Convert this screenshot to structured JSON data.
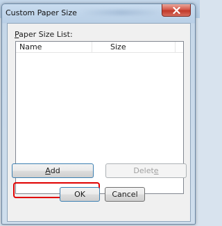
{
  "window": {
    "title": "Custom Paper Size",
    "close_icon": "close-icon"
  },
  "paper_size_list": {
    "label_accel": "P",
    "label_rest": "aper Size List:",
    "columns": [
      "Name",
      "Size"
    ],
    "rows": []
  },
  "buttons": {
    "add_accel": "A",
    "add_rest": "dd",
    "delete_prefix": "Delet",
    "delete_accel": "e",
    "ok": "OK",
    "cancel": "Cancel"
  },
  "colors": {
    "highlight": "#e00000",
    "close_button": "#c1392a"
  }
}
